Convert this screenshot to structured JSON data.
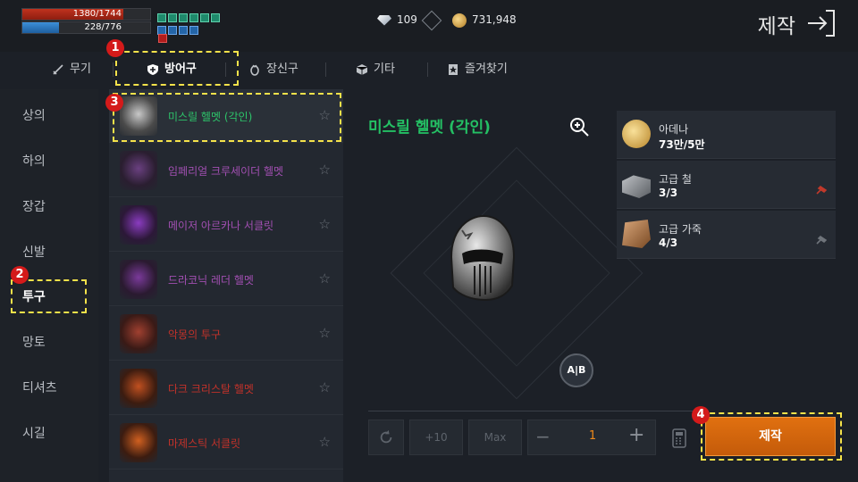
{
  "status": {
    "hp_text": "1380/1744",
    "hp_ratio": 0.79,
    "mp_text": "228/776",
    "mp_ratio": 0.29
  },
  "currency": {
    "gems": "109",
    "adena": "731,948"
  },
  "header": {
    "title": "제작"
  },
  "tabs": [
    {
      "label": "무기"
    },
    {
      "label": "방어구"
    },
    {
      "label": "장신구"
    },
    {
      "label": "기타"
    },
    {
      "label": "즐겨찾기"
    }
  ],
  "categories": [
    "상의",
    "하의",
    "장갑",
    "신발",
    "투구",
    "망토",
    "티셔츠",
    "시길"
  ],
  "items": [
    {
      "name": "미스릴 헬멧 (각인)",
      "color": "#2dc36a"
    },
    {
      "name": "임페리얼 크루세이더 헬멧",
      "color": "#a24fb2"
    },
    {
      "name": "메이저 아르카나 서클릿",
      "color": "#a24fb2"
    },
    {
      "name": "드라코닉 레더 헬멧",
      "color": "#a24fb2"
    },
    {
      "name": "악몽의 투구",
      "color": "#c2322a"
    },
    {
      "name": "다크 크리스탈 헬멧",
      "color": "#c2322a"
    },
    {
      "name": "마제스틱 서클릿",
      "color": "#c2322a"
    }
  ],
  "detail": {
    "name": "미스릴 헬멧 (각인)",
    "ab_label": "A|B"
  },
  "materials": [
    {
      "name": "아데나",
      "count": "73만/5만",
      "icon": "coin-icon"
    },
    {
      "name": "고급 철",
      "count": "3/3",
      "icon": "iron-icon"
    },
    {
      "name": "고급 가죽",
      "count": "4/3",
      "icon": "leather-icon"
    }
  ],
  "controls": {
    "plus10": "+10",
    "max": "Max",
    "quantity": "1",
    "craft_label": "제작"
  },
  "badges": [
    "1",
    "2",
    "3",
    "4"
  ]
}
